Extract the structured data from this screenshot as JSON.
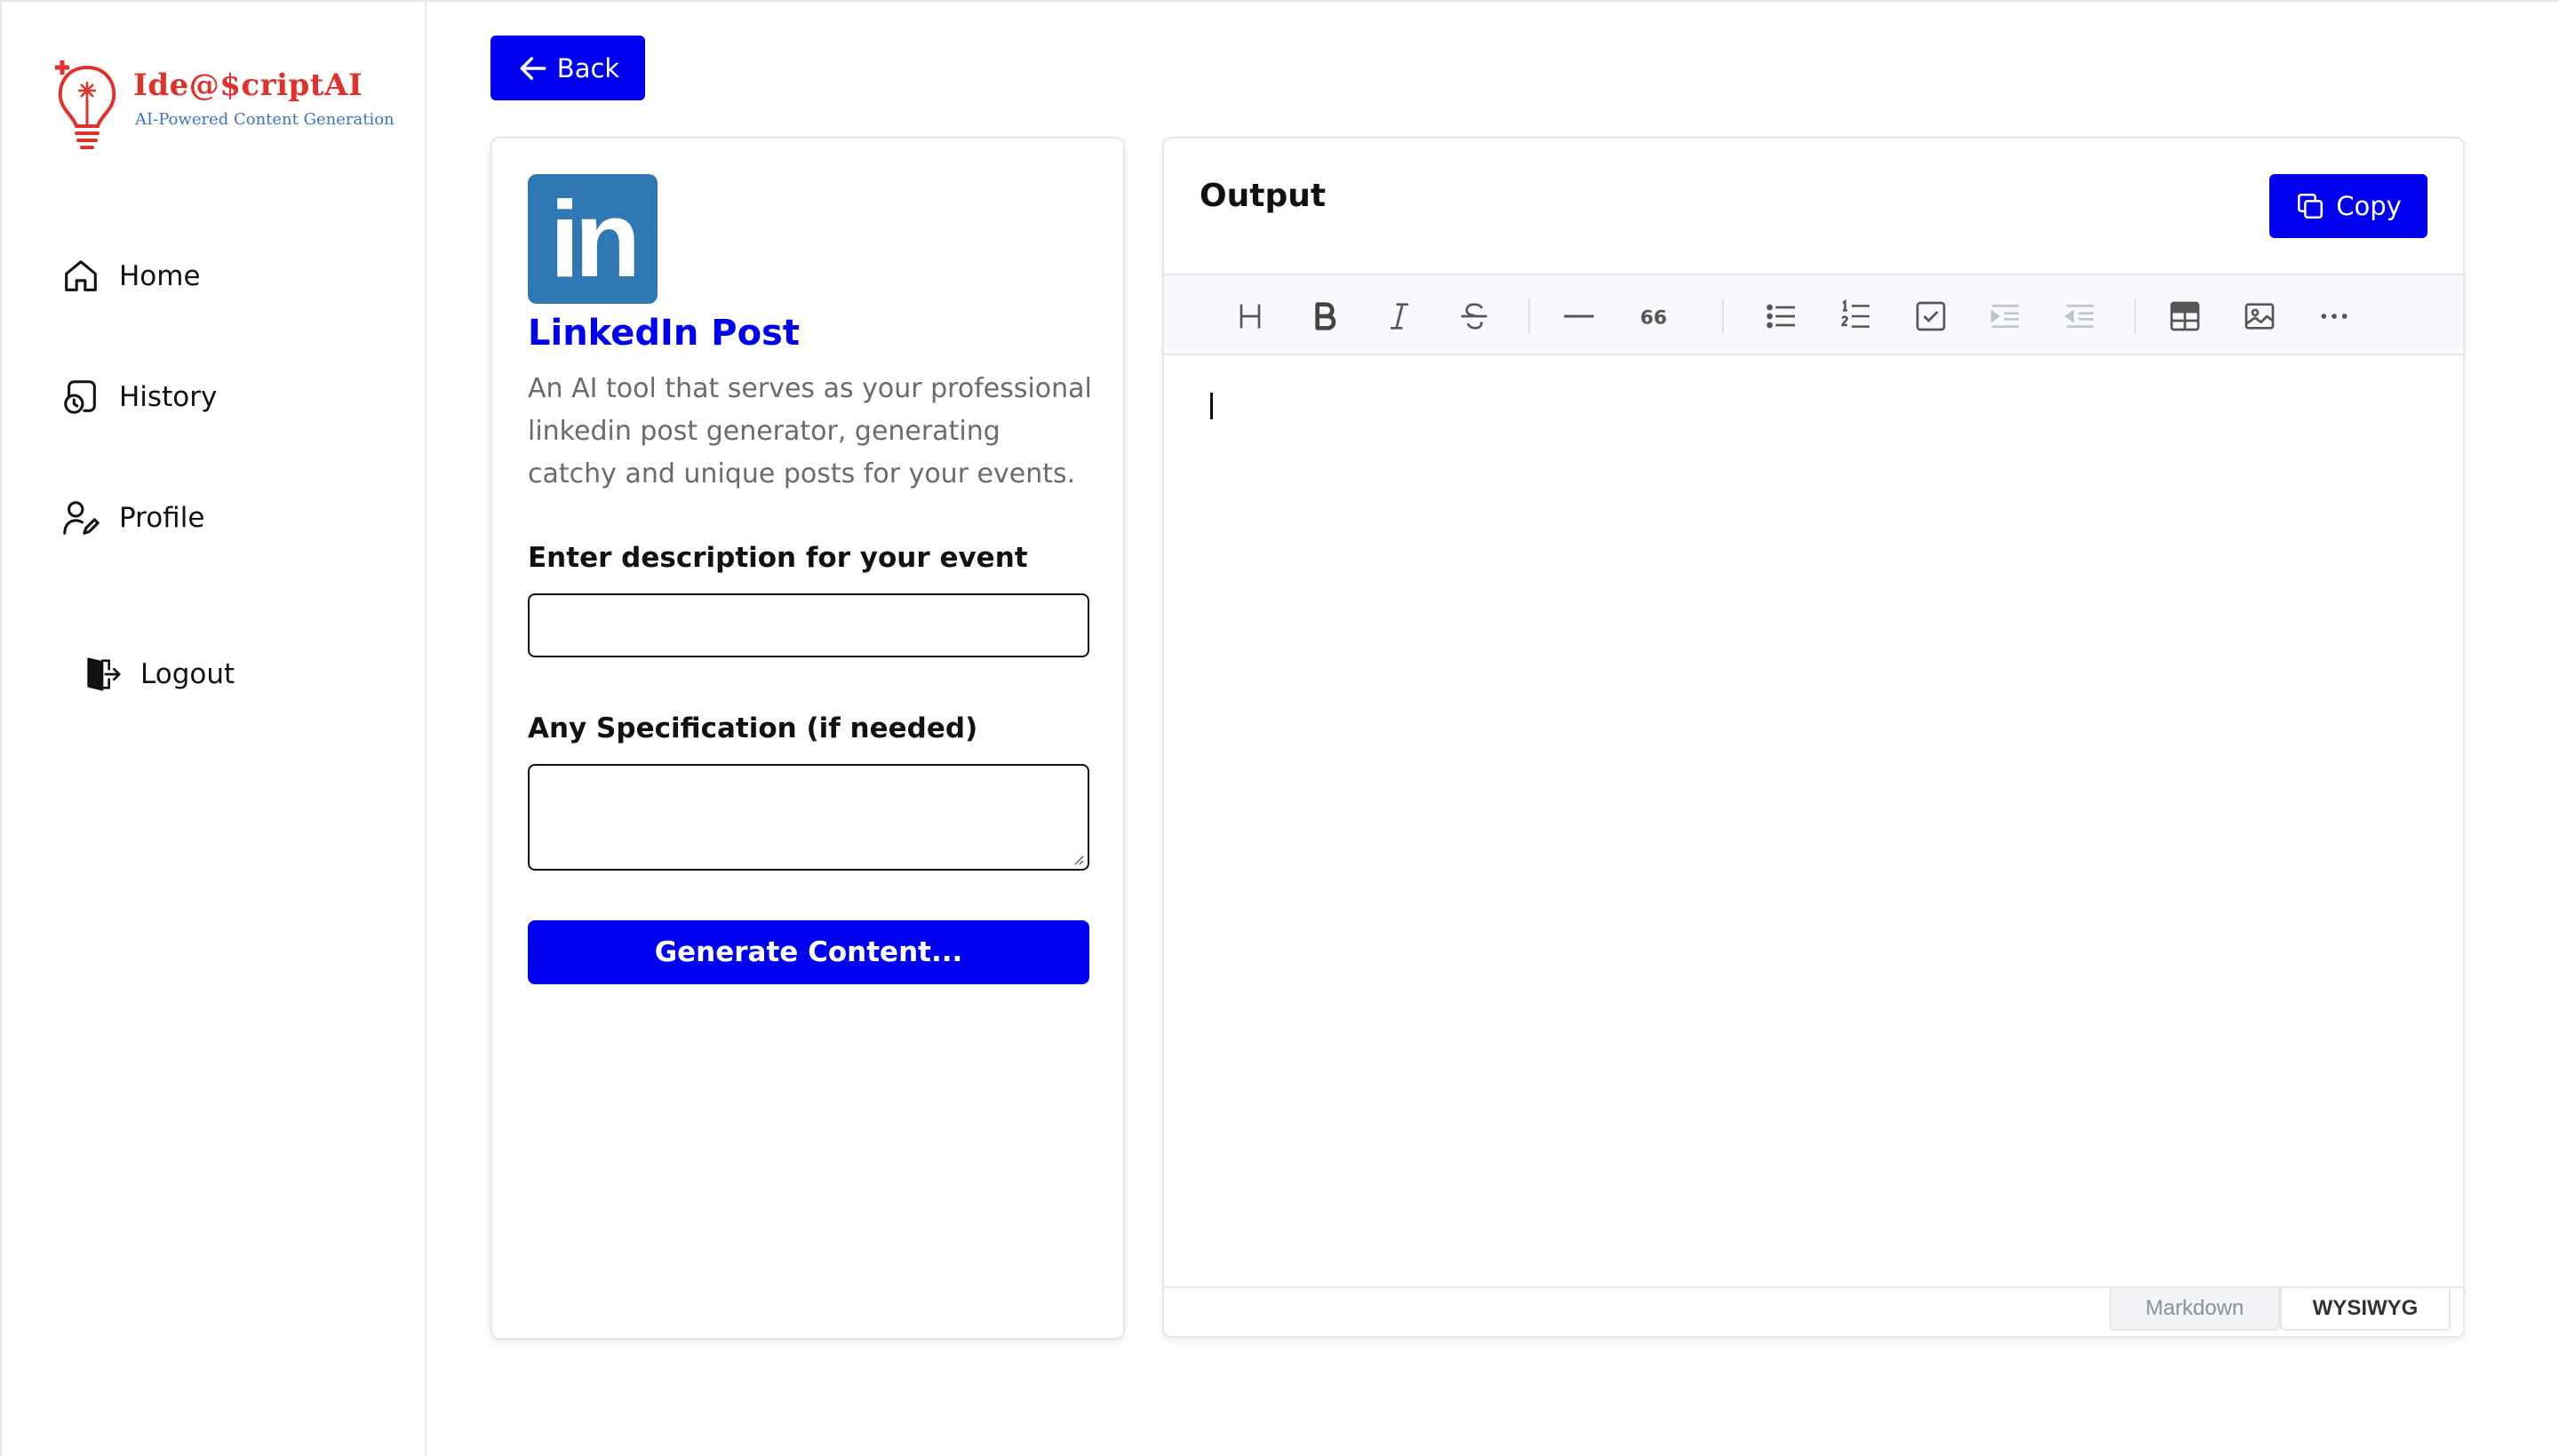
{
  "brand": {
    "name": "Ide@$criptAI",
    "tagline": "AI-Powered Content Generation"
  },
  "sidebar": {
    "items": [
      {
        "label": "Home",
        "icon": "home-icon"
      },
      {
        "label": "History",
        "icon": "history-icon"
      },
      {
        "label": "Profile",
        "icon": "profile-icon"
      },
      {
        "label": "Logout",
        "icon": "logout-icon"
      }
    ]
  },
  "back_label": "Back",
  "tool": {
    "title": "LinkedIn Post",
    "logo_text": "in",
    "description": "An AI tool that serves as your professional linkedin post generator, generating catchy and unique posts for your events.",
    "field1_label": "Enter description for your event",
    "field1_value": "",
    "field2_label": "Any Specification (if needed)",
    "field2_value": "",
    "generate_label": "Generate Content..."
  },
  "output": {
    "title": "Output",
    "copy_label": "Copy",
    "toolbar": [
      "heading-icon",
      "bold-icon",
      "italic-icon",
      "strikethrough-icon",
      "horizontal-rule-icon",
      "quote-icon",
      "bullet-list-icon",
      "ordered-list-icon",
      "task-list-icon",
      "indent-icon",
      "outdent-icon",
      "table-icon",
      "image-icon",
      "more-icon"
    ],
    "quote_glyph": "66",
    "modes": {
      "markdown": "Markdown",
      "wysiwyg": "WYSIWYG"
    },
    "active_mode": "WYSIWYG"
  },
  "colors": {
    "accent": "#0000f0",
    "brand_red": "#e0322a",
    "linkedin_blue": "#2f78b4"
  }
}
